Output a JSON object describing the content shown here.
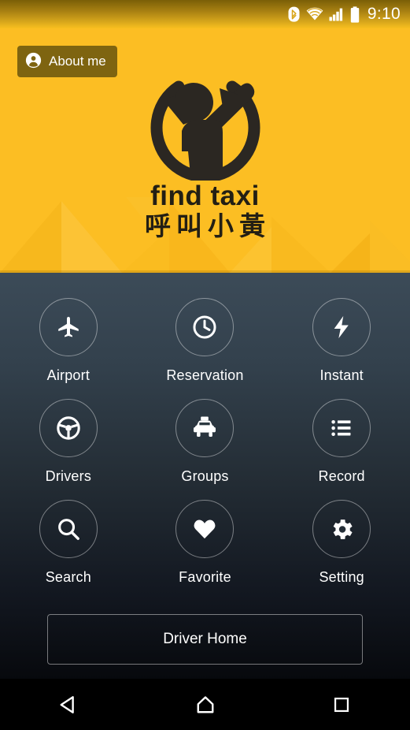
{
  "status_bar": {
    "time": "9:10",
    "icons": [
      "bluetooth-icon",
      "wifi-icon",
      "cellular-signal-icon",
      "battery-icon"
    ]
  },
  "header": {
    "background_color": "#fcbe23",
    "about_button": {
      "label": "About me",
      "icon": "person-icon",
      "background_color": "#7e6410"
    },
    "logo": {
      "icon": "find-taxi-person-logo",
      "title": "find taxi",
      "subtitle": "呼叫小黃",
      "text_color": "#231f14"
    }
  },
  "main": {
    "background_gradient": [
      "#3c4b58",
      "#07090d"
    ],
    "grid": [
      {
        "label": "Airport",
        "icon": "airplane-icon"
      },
      {
        "label": "Reservation",
        "icon": "clock-icon"
      },
      {
        "label": "Instant",
        "icon": "lightning-bolt-icon"
      },
      {
        "label": "Drivers",
        "icon": "steering-wheel-icon"
      },
      {
        "label": "Groups",
        "icon": "taxi-icon"
      },
      {
        "label": "Record",
        "icon": "list-icon"
      },
      {
        "label": "Search",
        "icon": "magnifier-icon"
      },
      {
        "label": "Favorite",
        "icon": "heart-icon"
      },
      {
        "label": "Setting",
        "icon": "gear-icon"
      }
    ],
    "driver_home_button": {
      "label": "Driver Home"
    }
  },
  "nav_bar": {
    "background_color": "#000000",
    "buttons": [
      {
        "name": "back",
        "icon": "back-triangle-icon"
      },
      {
        "name": "home",
        "icon": "home-pentagon-icon"
      },
      {
        "name": "recents",
        "icon": "recents-square-icon"
      }
    ]
  }
}
